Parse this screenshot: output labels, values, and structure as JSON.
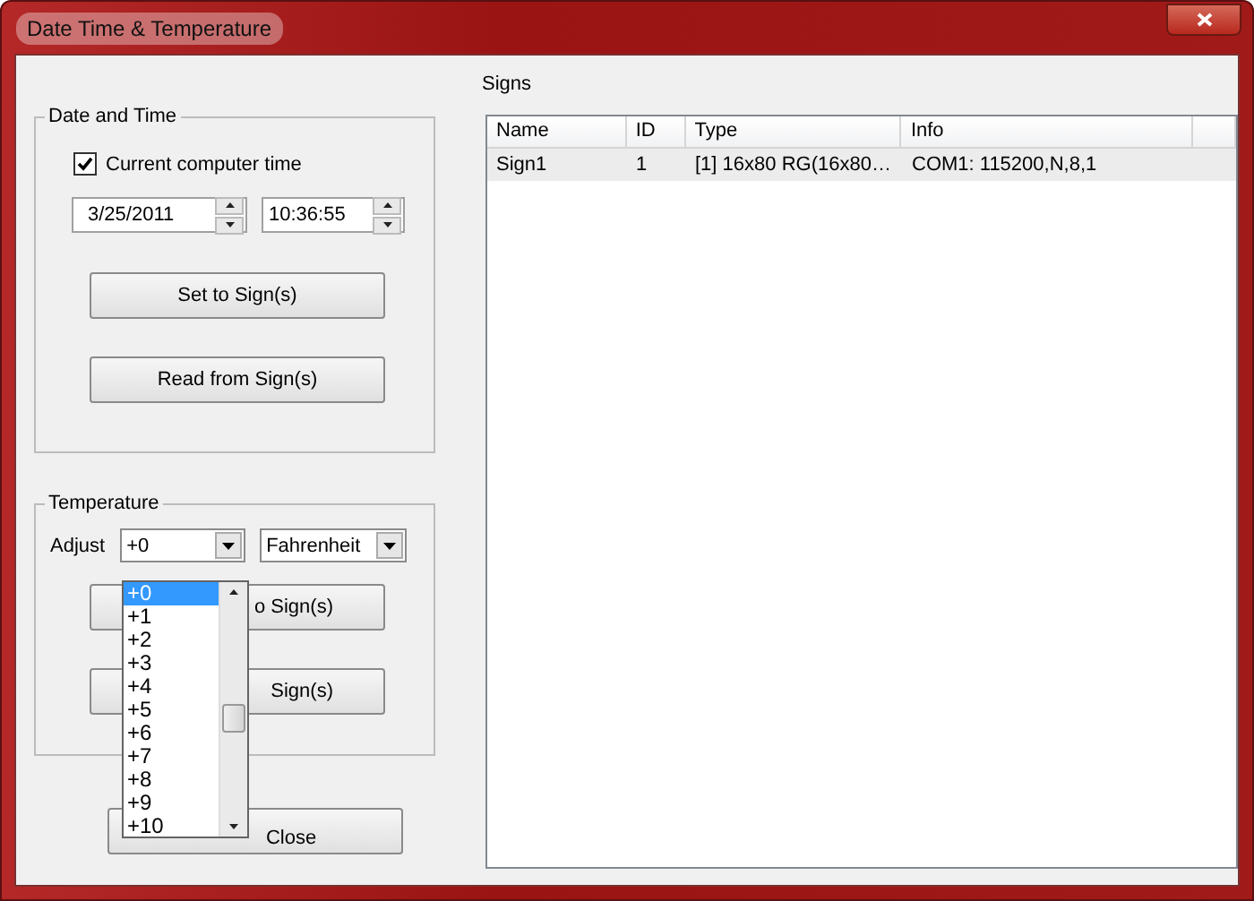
{
  "window": {
    "title": "Date Time & Temperature"
  },
  "date_time": {
    "title": "Date and Time",
    "current_computer_time": {
      "label": "Current computer time",
      "checked": true
    },
    "date": "3/25/2011",
    "time": "10:36:55",
    "buttons": [
      "Set to Sign(s)",
      "Read from Sign(s)"
    ]
  },
  "temperature": {
    "title": "Temperature",
    "adjust_label": "Adjust",
    "adjust_value": "+0",
    "unit": "Fahrenheit",
    "buttons": [
      "o Sign(s)",
      "Sign(s)"
    ],
    "adjust_list": {
      "expanded": true,
      "items": [
        {
          "label": "+0",
          "selected": true
        },
        {
          "label": "+1",
          "selected": false
        },
        {
          "label": "+2",
          "selected": false
        },
        {
          "label": "+3",
          "selected": false
        },
        {
          "label": "+4",
          "selected": false
        },
        {
          "label": "+5",
          "selected": false
        },
        {
          "label": "+6",
          "selected": false
        },
        {
          "label": "+7",
          "selected": false
        },
        {
          "label": "+8",
          "selected": false
        },
        {
          "label": "+9",
          "selected": false
        },
        {
          "label": "+10",
          "selected": false
        }
      ]
    }
  },
  "close_button": "Close",
  "signs": {
    "title": "Signs",
    "columns": [
      "Name",
      "ID",
      "Type",
      "Info"
    ],
    "rows": [
      {
        "cells": [
          "Sign1",
          "1",
          "[1] 16x80 RG(16x80…",
          "COM1: 115200,N,8,1"
        ],
        "selected": true
      }
    ]
  }
}
